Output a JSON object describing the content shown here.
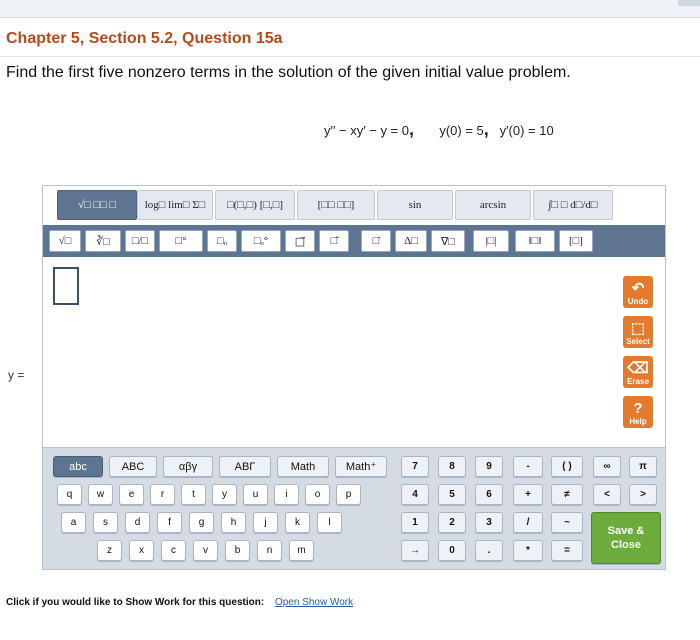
{
  "header": {
    "title": "Chapter 5, Section 5.2, Question 15a",
    "question": "Find the first five nonzero terms in the solution of the given initial value problem."
  },
  "equation": {
    "ode": "y′′ − xy′ − y = 0",
    "ic1": "y(0) = 5",
    "ic2": "y′(0) = 10"
  },
  "answer": {
    "prefix": "y ="
  },
  "toolbar_row1": [
    "√□ □□ □",
    "log□ lim□ Σ□",
    "□(□,□) [□,□]",
    "[□□ □□]",
    "sin",
    "arcsin",
    "∫□ □ d□/d□"
  ],
  "toolbar_row2": [
    "√□",
    "∛□",
    "□/□",
    "□°",
    "□ₒ",
    "□ₒ°",
    "□⃗",
    "□̂",
    "□̇",
    "Δ□",
    "∇□",
    "|□|",
    "‖□‖",
    "[□]"
  ],
  "side_buttons": {
    "undo": "Undo",
    "select": "Select",
    "erase": "Erase",
    "help": "Help"
  },
  "keyboard": {
    "tabs": [
      "abc",
      "ABC",
      "αβγ",
      "ABΓ",
      "Math",
      "Math⁺"
    ],
    "letters_row1": [
      "q",
      "w",
      "e",
      "r",
      "t",
      "y",
      "u",
      "i",
      "o",
      "p"
    ],
    "letters_row2": [
      "a",
      "s",
      "d",
      "f",
      "g",
      "h",
      "j",
      "k",
      "l"
    ],
    "letters_row3": [
      "z",
      "x",
      "c",
      "v",
      "b",
      "n",
      "m"
    ],
    "num_rows": [
      [
        "7",
        "8",
        "9",
        "-",
        "( )",
        "∞",
        "π"
      ],
      [
        "4",
        "5",
        "6",
        "+",
        "≠",
        "<",
        ">"
      ],
      [
        "1",
        "2",
        "3",
        "/",
        "~"
      ],
      [
        "→",
        "0",
        ".",
        "*",
        "="
      ]
    ],
    "save_label": "Save & Close"
  },
  "footer": {
    "prompt": "Click if you would like to Show Work for this question:",
    "link": "Open Show Work"
  }
}
